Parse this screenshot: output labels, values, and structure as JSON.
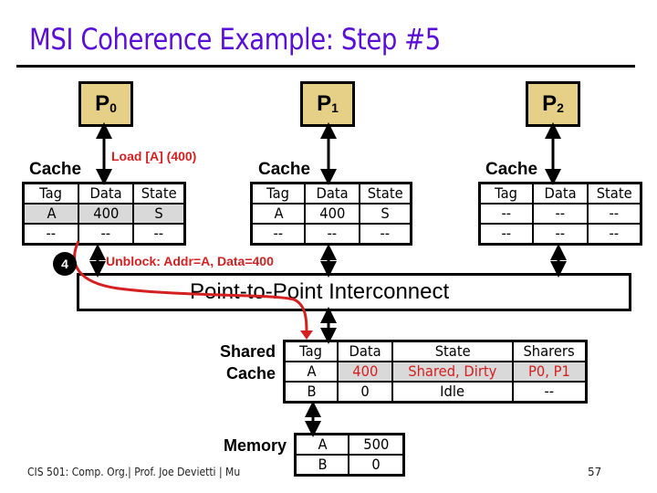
{
  "slide": {
    "title": "MSI Coherence Example: Step #5",
    "footer": "CIS 501: Comp. Org.| Prof. Joe Devietti | Mu",
    "page_number": "57"
  },
  "processors": [
    {
      "name": "P",
      "sub": "0"
    },
    {
      "name": "P",
      "sub": "1"
    },
    {
      "name": "P",
      "sub": "2"
    }
  ],
  "annotations": {
    "load": "Load [A]  (400)",
    "unblock": "Unblock: Addr=A, Data=400",
    "step_number": "4"
  },
  "caches": [
    {
      "label": "Cache",
      "headers": [
        "Tag",
        "Data",
        "State"
      ],
      "rows": [
        [
          "A",
          "400",
          "S"
        ],
        [
          "--",
          "--",
          "--"
        ]
      ],
      "highlighted_row": 0
    },
    {
      "label": "Cache",
      "headers": [
        "Tag",
        "Data",
        "State"
      ],
      "rows": [
        [
          "A",
          "400",
          "S"
        ],
        [
          "--",
          "--",
          "--"
        ]
      ]
    },
    {
      "label": "Cache",
      "headers": [
        "Tag",
        "Data",
        "State"
      ],
      "rows": [
        [
          "--",
          "--",
          "--"
        ],
        [
          "--",
          "--",
          "--"
        ]
      ]
    }
  ],
  "interconnect": {
    "label": "Point-to-Point Interconnect"
  },
  "shared_cache": {
    "label_line1": "Shared",
    "label_line2": "Cache",
    "headers": [
      "Tag",
      "Data",
      "State",
      "Sharers"
    ],
    "rows": [
      [
        "A",
        "400",
        "Shared, Dirty",
        "P0, P1"
      ],
      [
        "B",
        "0",
        "Idle",
        "--"
      ]
    ],
    "highlight_color": "#d42020"
  },
  "memory": {
    "label": "Memory",
    "rows": [
      [
        "A",
        "500"
      ],
      [
        "B",
        "0"
      ]
    ]
  },
  "colors": {
    "title": "#5a0fd6",
    "processor_fill": "#e6cf86",
    "highlight_gray": "#d9d9d9",
    "accent_red": "#d42020"
  }
}
